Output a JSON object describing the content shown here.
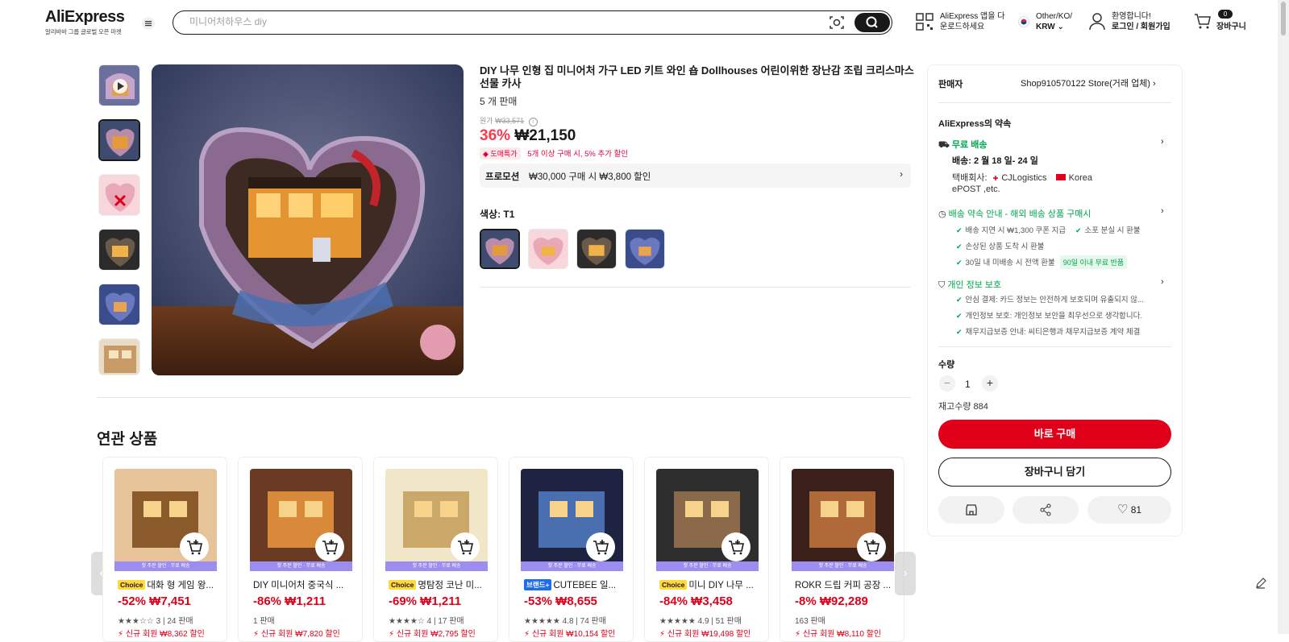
{
  "header": {
    "logo": "AliExpress",
    "logo_sub": "알리바바 그룹 글로벌 오픈 마켓",
    "search_placeholder": "미니어처하우스 diy",
    "app_line1": "AliExpress 앱을 다",
    "app_line2": "운로드하세요",
    "locale_line1": "Other/KO/",
    "locale_line2": "KRW",
    "account_line1": "환영합니다!",
    "account_line2": "로그인 / 회원가입",
    "cart_count": "0",
    "cart_label": "장바구니"
  },
  "product": {
    "title": "DIY 나무 인형 집 미니어처 가구 LED 키트 와인 숍 Dollhouses 어린이위한 장난감 조립 크리스마스 선물 카사",
    "sold": "5 개 판매",
    "original_label": "원가",
    "original_price": "₩33,571",
    "discount": "36%",
    "price": "₩21,150",
    "badge": "도매특가",
    "bulk_note": "5개 이상 구매 시, 5% 추가 할인",
    "promo_label": "프로모션",
    "promo_text": "₩30,000 구매 시 ₩3,800 할인",
    "color_label": "색상: T1"
  },
  "panel": {
    "seller_label": "판매자",
    "seller_name": "Shop910570122 Store",
    "seller_type": "(거래 업체)",
    "promise_title": "AliExpress의 약속",
    "free_shipping": "무료 배송",
    "delivery": "배송: 2 월 18 일- 24 일",
    "carrier_label": "택배회사:",
    "carrier1": "CJLogistics",
    "carrier2": "Korea",
    "carrier3": "ePOST ,etc.",
    "delivery_promise": "배송 약속 안내 - 해외 배송 상품 구매시",
    "dp_items": [
      "배송 지연 시 ₩1,300 쿠폰 지급",
      "소포 분실 시 환불",
      "손상된 상품 도착 시 환불",
      "30일 내 미배송 시 전액 환불"
    ],
    "return_tag": "90일 이내 무료 반품",
    "privacy": "개인 정보 보호",
    "privacy_items": [
      "안심 결제: 카드 정보는 안전하게 보호되며 유출되지 않...",
      "개인정보 보호: 개인정보 보안을 최우선으로 생각합니다.",
      "채무지급보증 안내: 씨티은행과 채무지급보증 계약 체결"
    ],
    "qty_label": "수량",
    "qty_value": "1",
    "stock": "재고수량 884",
    "buy_label": "바로 구매",
    "cart_label": "장바구니 담기",
    "wish_count": "81"
  },
  "related": {
    "title": "연관 상품",
    "strip": "첫 주문 할인 · 무료 배송",
    "cards": [
      {
        "chip": "Choice",
        "chip_type": "choice",
        "name": "대화 형 게임 왕...",
        "price": "-52% ₩7,451",
        "rating": "★★★☆☆ 3 | 24 판매",
        "new": "신규 회원 ₩8,362 할인"
      },
      {
        "chip": "",
        "chip_type": "",
        "name": "DIY 미니어처 중국식 ...",
        "price": "-86% ₩1,211",
        "rating": "1 판매",
        "new": "신규 회원 ₩7,820 할인"
      },
      {
        "chip": "Choice",
        "chip_type": "choice",
        "name": "명탐정 코난 미...",
        "price": "-69% ₩1,211",
        "rating": "★★★★☆ 4 | 17 판매",
        "new": "신규 회원 ₩2,795 할인"
      },
      {
        "chip": "브랜드+",
        "chip_type": "brand",
        "name": "CUTEBEE 일...",
        "price": "-53% ₩8,655",
        "rating": "★★★★★ 4.8 | 74 판매",
        "new": "신규 회원 ₩10,154 할인"
      },
      {
        "chip": "Choice",
        "chip_type": "choice",
        "name": "미니 DIY 나무 ...",
        "price": "-84% ₩3,458",
        "rating": "★★★★★ 4.9 | 51 판매",
        "new": "신규 회원 ₩19,498 할인"
      },
      {
        "chip": "",
        "chip_type": "",
        "name": "ROKR 드립 커피 공장 ...",
        "price": "-8% ₩92,289",
        "rating": "163 판매",
        "new": "신규 회원 ₩8,110 할인"
      }
    ]
  }
}
